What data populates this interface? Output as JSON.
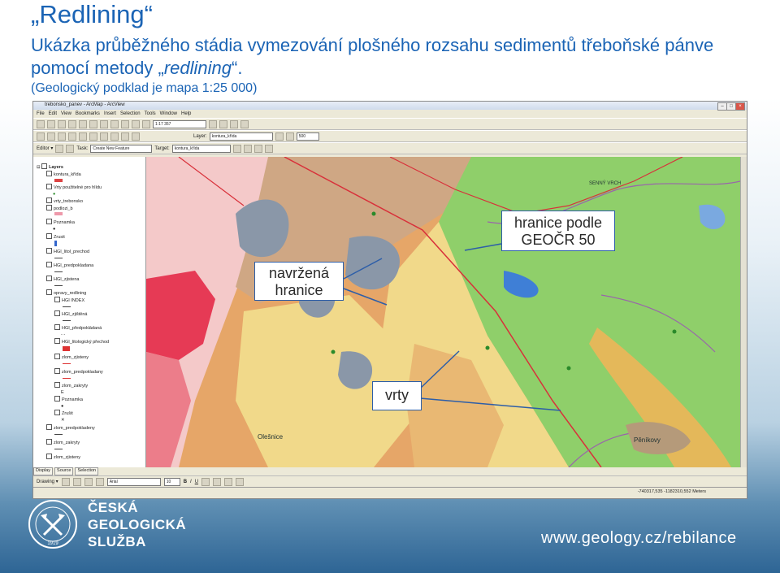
{
  "slide": {
    "title": "„Redlining“",
    "subtitle_part1": "Ukázka průběžného stádia vymezování plošného rozsahu sedimentů třeboňské pánve pomocí metody „",
    "subtitle_em": "redlining",
    "subtitle_part2": "“.",
    "note": "(Geologický podklad je mapa 1:25 000)"
  },
  "app": {
    "window_title": "trebonsko_panev - ArcMap - ArcView",
    "menu": [
      "File",
      "Edit",
      "View",
      "Bookmarks",
      "Insert",
      "Selection",
      "Tools",
      "Window",
      "Help"
    ],
    "scale_value": "1:17 357",
    "layer_label": "Layer:",
    "layer_value": "kontura_křída",
    "editor_label": "Editor ▾",
    "task_label": "Task:",
    "task_value": "Create New Feature",
    "target_label": "Target:",
    "target_value": "kontura_křída",
    "snap_value": "500",
    "toc": {
      "root": "Layers",
      "items": [
        "kontura_křída",
        "Vrty použitelné pro hlídu",
        "vrty_trebonsko",
        "podlozi_b",
        "Poznamka",
        "Zrusit",
        "HGI_litol_prechod",
        "HGI_predpokladana",
        "HGI_zjistena",
        "opravy_redlining",
        "HGI INDEX",
        "HGI_zjištěná",
        "HGI_předpokládaná",
        "HGI_litologický přechod",
        "zlom_zjisteny",
        "zlom_predpokladany",
        "zlom_zakryty",
        "Poznamka",
        "Zrušit",
        "zlom_predpokladeny",
        "zlom_zakryty",
        "zlom_zjisteny"
      ],
      "tabs": [
        "Display",
        "Source",
        "Selection"
      ]
    },
    "drawing_label": "Drawing ▾",
    "font_value": "Arial",
    "font_size": "10",
    "status_coords": "-740317,535 -1182310,552 Meters",
    "map_labels": {
      "place1": "SENNÝ VRCH",
      "place2": "Olešnice",
      "place3": "Pěníkovy"
    }
  },
  "callouts": {
    "hranice": "hranice podle GEOČR 50",
    "navrzena": "navržená hranice",
    "vrty": "vrty"
  },
  "footer": {
    "org_line1": "ČESKÁ",
    "org_line2": "GEOLOGICKÁ",
    "org_line3": "SLUŽBA",
    "year": "1919",
    "website": "www.geology.cz/rebilance"
  },
  "colors": {
    "accent": "#1b64b5",
    "callout_border": "#2d5ea8",
    "redline": "#d8303a",
    "map_green": "#8fcf6a",
    "map_orange": "#e6a668",
    "map_yellow": "#f1d98a"
  }
}
